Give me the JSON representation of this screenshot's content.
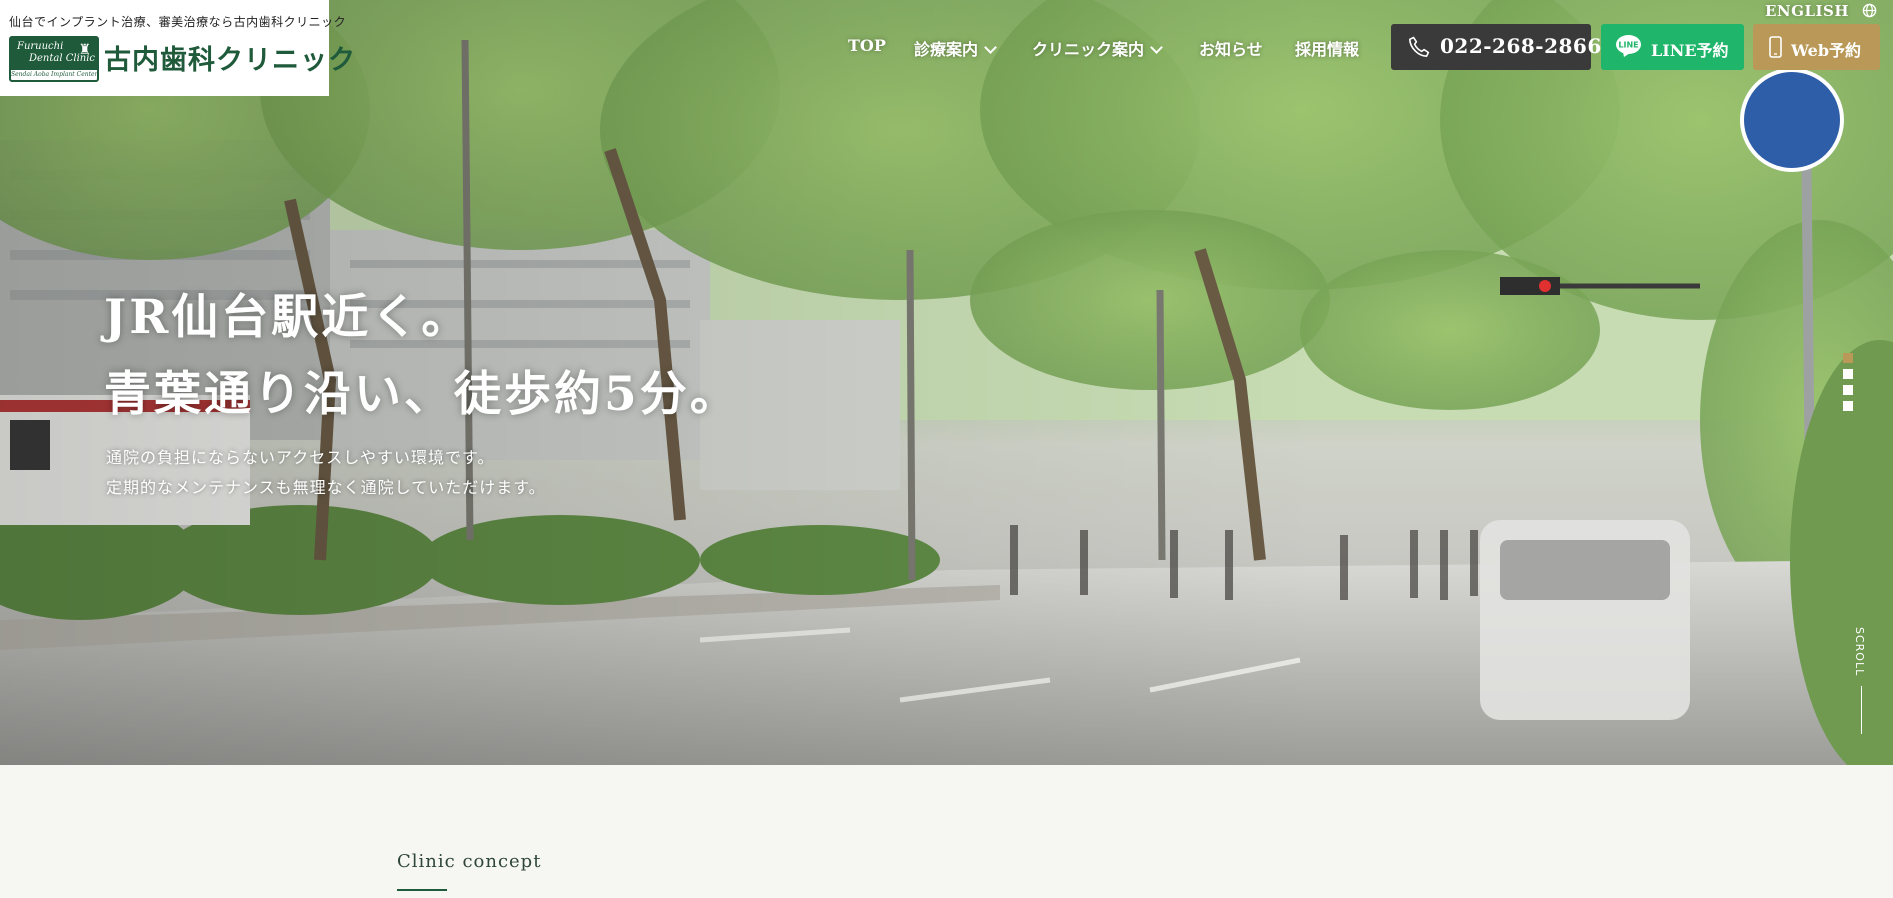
{
  "header": {
    "tagline": "仙台でインプラント治療、審美治療なら古内歯科クリニック",
    "emblem": {
      "line1": "Furuuchi",
      "line2": "Dental Clinic",
      "line3": "Sendai Aoba Implant Center"
    },
    "clinic_name": "古内歯科クリニック",
    "english_label": "ENGLISH",
    "icons": {
      "globe": "globe-icon",
      "phone": "phone-icon",
      "line": "line-icon",
      "smartphone": "smartphone-icon"
    }
  },
  "nav": {
    "items": [
      {
        "label": "TOP",
        "dropdown": false
      },
      {
        "label": "診療案内",
        "dropdown": true
      },
      {
        "label": "クリニック案内",
        "dropdown": true
      },
      {
        "label": "お知らせ",
        "dropdown": false
      },
      {
        "label": "採用情報",
        "dropdown": false
      }
    ],
    "tel": "022-268-2866",
    "line_label": "LINE予約",
    "web_label": "Web予約"
  },
  "hero": {
    "title_line1": "JR仙台駅近く。",
    "title_line2": "青葉通り沿い、徒歩約5分。",
    "sub_line1": "通院の負担にならないアクセスしやすい環境です。",
    "sub_line2": "定期的なメンテナンスも無理なく通院していただけます。",
    "slides_total": 4,
    "active_slide": 1,
    "scroll_label": "SCROLL"
  },
  "concept": {
    "label": "Clinic concept"
  },
  "colors": {
    "brand_green": "#1f5a3a",
    "tel_bg": "#3a3a3a",
    "line_green": "#1fb56a",
    "web_gold": "#b99858",
    "page_bg": "#f6f6f3"
  }
}
